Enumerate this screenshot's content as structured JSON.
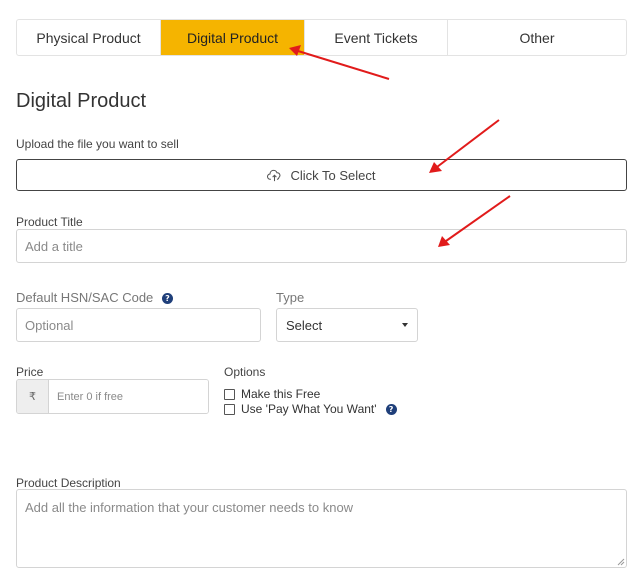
{
  "tabs": [
    {
      "label": "Physical Product",
      "active": false
    },
    {
      "label": "Digital Product",
      "active": true
    },
    {
      "label": "Event Tickets",
      "active": false
    },
    {
      "label": "Other",
      "active": false
    }
  ],
  "heading": "Digital Product",
  "upload": {
    "label": "Upload the file you want to sell",
    "button_label": "Click To Select",
    "icon": "cloud-upload-icon"
  },
  "product_title": {
    "label": "Product Title",
    "placeholder": "Add a title",
    "value": ""
  },
  "hsn": {
    "label": "Default HSN/SAC Code",
    "placeholder": "Optional",
    "value": "",
    "help_icon": "?"
  },
  "type": {
    "label": "Type",
    "selected": "Select"
  },
  "price": {
    "label": "Price",
    "currency_symbol": "₹",
    "placeholder": "Enter 0 if free",
    "value": ""
  },
  "options": {
    "label": "Options",
    "make_free": {
      "label": "Make this Free",
      "checked": false
    },
    "pay_what_you_want": {
      "label": "Use 'Pay What You Want'",
      "checked": false,
      "help_icon": "?"
    }
  },
  "description": {
    "label": "Product Description",
    "placeholder": "Add all the information that your customer needs to know",
    "value": ""
  },
  "colors": {
    "active_tab": "#f5b400",
    "annotation_arrow": "#e11b1b",
    "help_icon": "#1f3f7a"
  }
}
